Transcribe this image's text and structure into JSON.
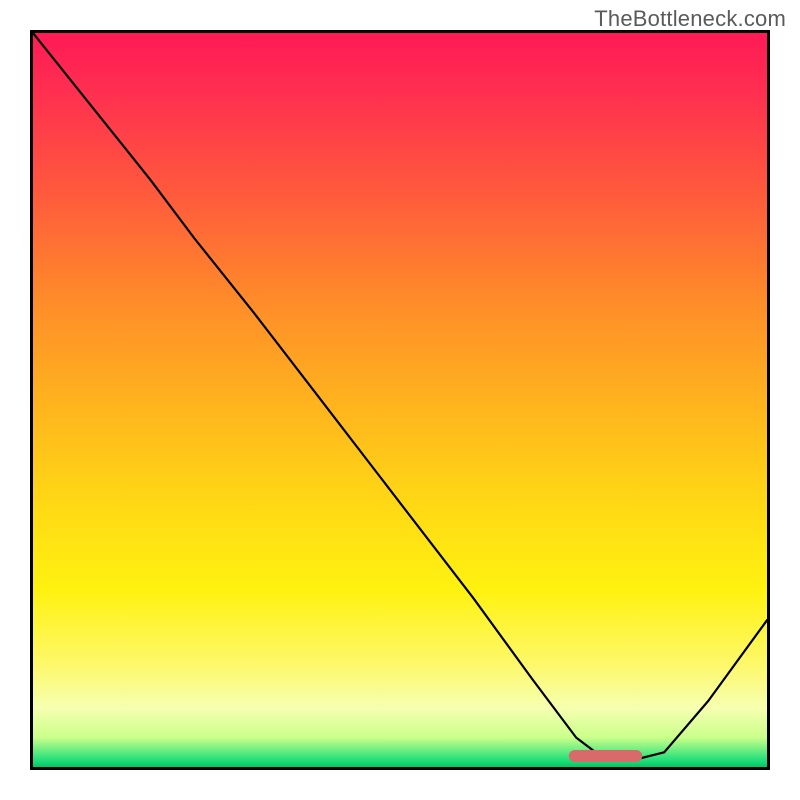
{
  "watermark": "TheBottleneck.com",
  "chart_data": {
    "type": "line",
    "title": "",
    "xlabel": "",
    "ylabel": "",
    "xlim": [
      0,
      100
    ],
    "ylim": [
      0,
      100
    ],
    "grid": false,
    "legend": false,
    "series": [
      {
        "name": "bottleneck-curve",
        "x": [
          0,
          8,
          16,
          22,
          30,
          40,
          50,
          60,
          68,
          74,
          78,
          82,
          86,
          92,
          100
        ],
        "y": [
          100,
          90,
          80,
          72,
          62,
          49,
          36,
          23,
          12,
          4,
          1,
          1,
          2,
          9,
          20
        ]
      }
    ],
    "marker": {
      "name": "optimal-range",
      "shape": "rounded-bar",
      "x_start": 73,
      "x_end": 83,
      "y": 1.5,
      "color": "#d96a6a"
    },
    "gradient_stops": [
      {
        "pos": 0.0,
        "color": "#ff1a56"
      },
      {
        "pos": 0.5,
        "color": "#ffd815"
      },
      {
        "pos": 0.9,
        "color": "#fdf86a"
      },
      {
        "pos": 1.0,
        "color": "#00c864"
      }
    ]
  }
}
